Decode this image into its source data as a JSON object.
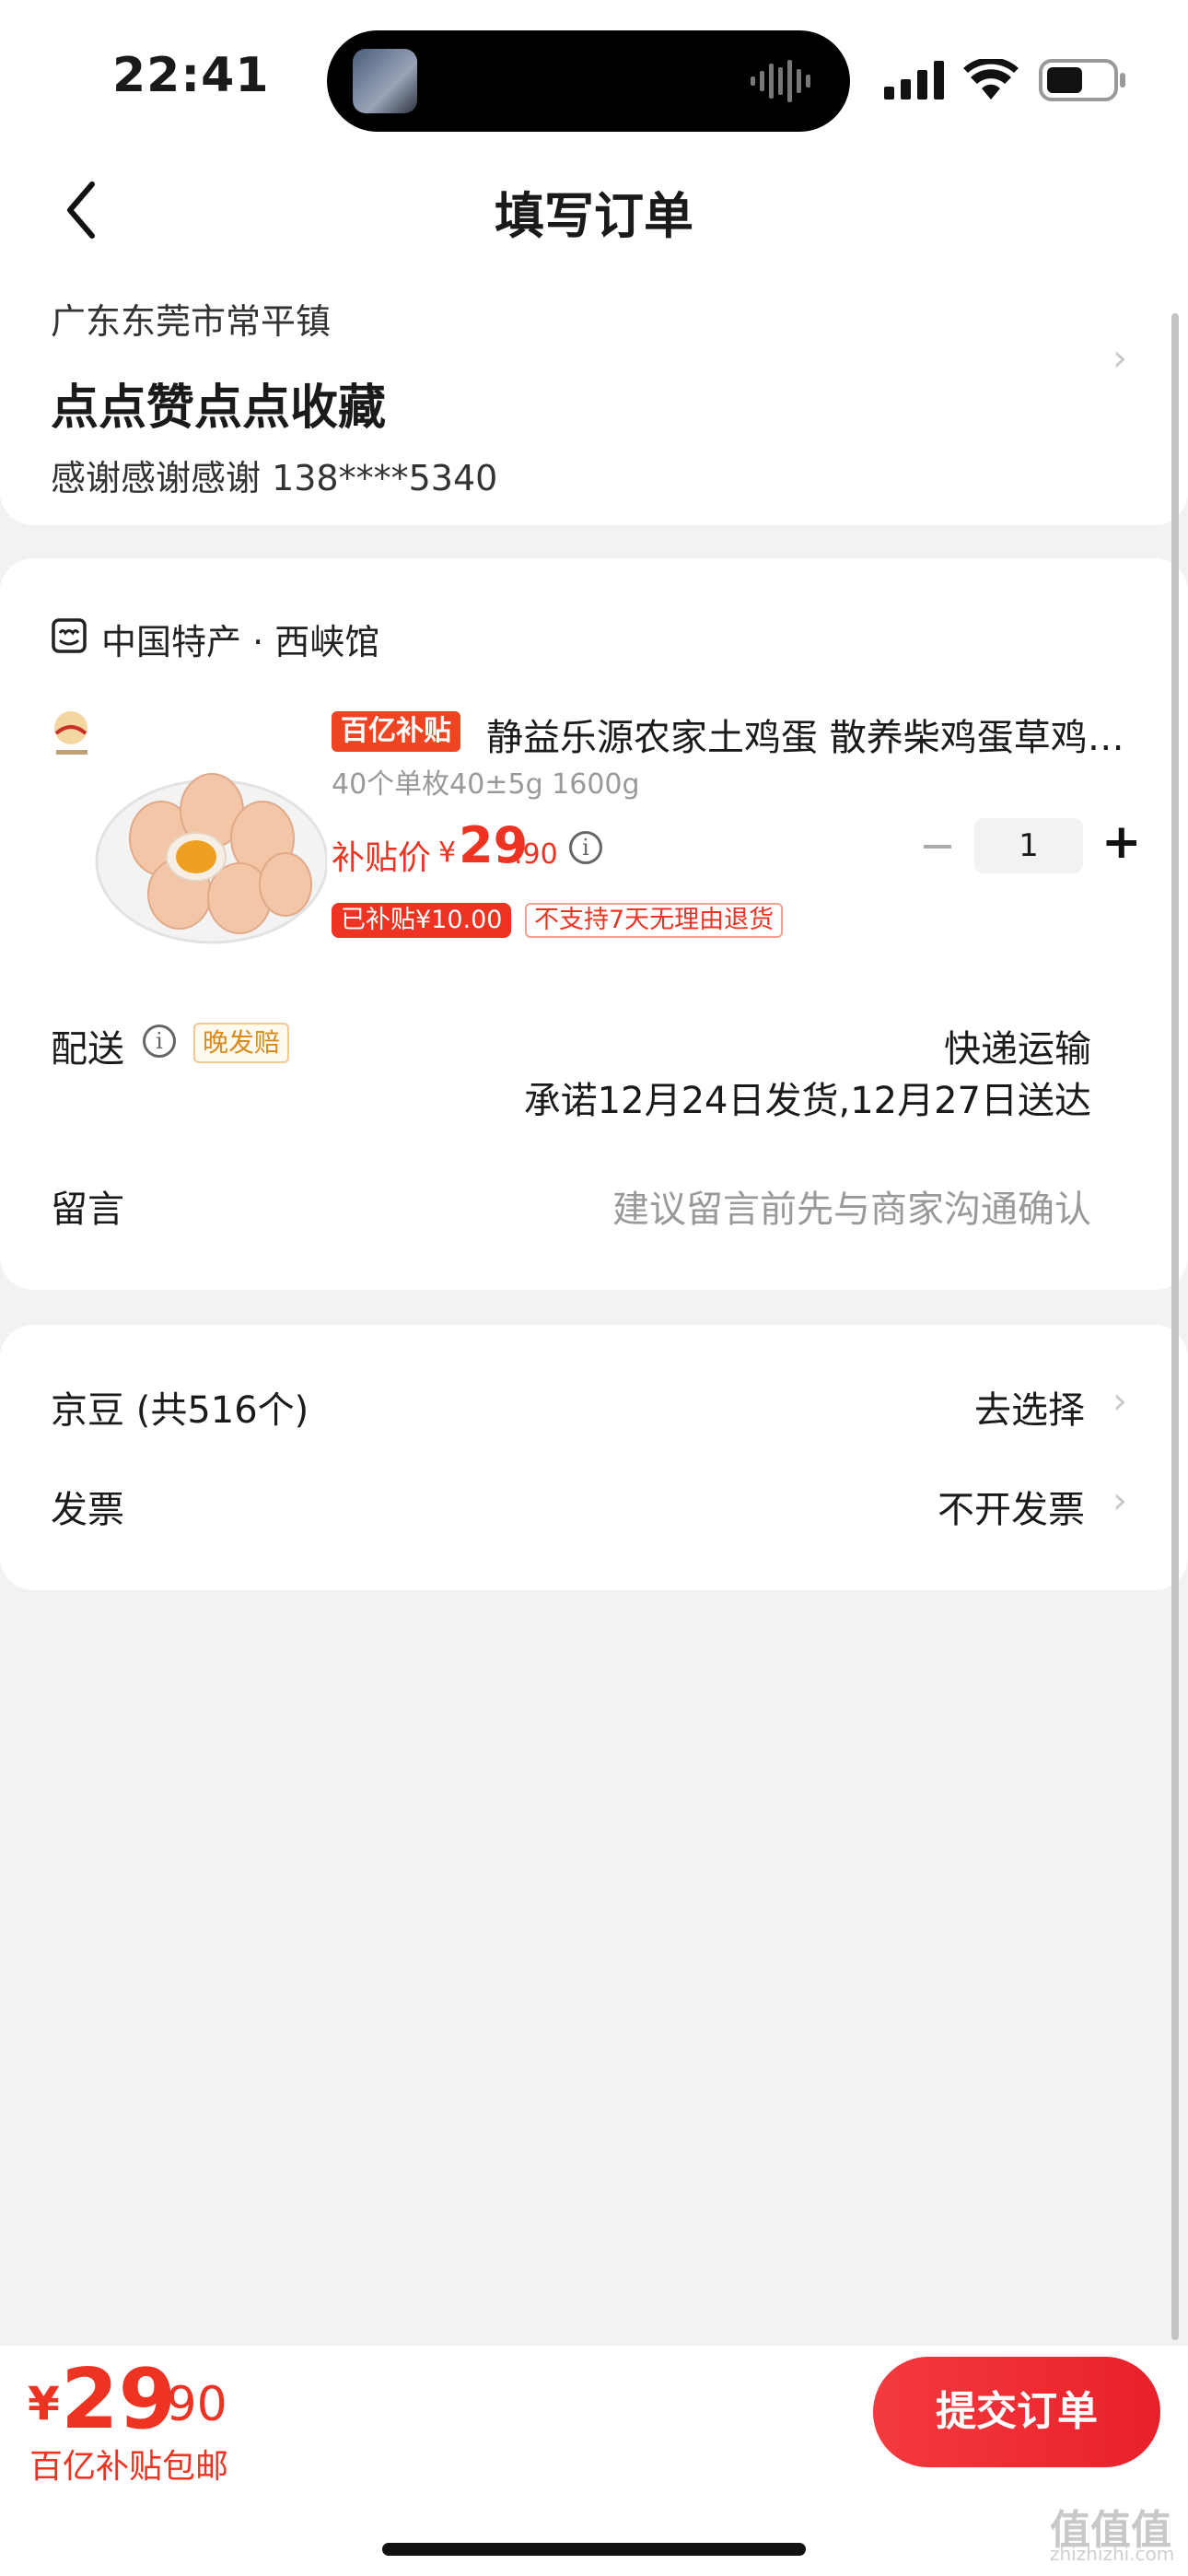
{
  "status_bar": {
    "time": "22:41"
  },
  "header": {
    "title": "填写订单"
  },
  "address": {
    "region": "广东东莞市常平镇",
    "detail": "点点赞点点收藏",
    "contact": "感谢感谢感谢  138****5340"
  },
  "shop": {
    "name": "中国特产 · 西峡馆",
    "product": {
      "badge": "百亿补贴",
      "title": "静益乐源农家土鸡蛋 散养柴鸡蛋草鸡…",
      "spec": "40个单枚40±5g 1600g",
      "price_label": "补贴价",
      "price_yen": "¥",
      "price_int": "29",
      "price_dec": ".90",
      "quantity": "1",
      "subsidy_tag": "已补贴¥10.00",
      "return_tag": "不支持7天无理由退货"
    },
    "delivery": {
      "label": "配送",
      "late_tag": "晚发赔",
      "method": "快递运输",
      "promise": "承诺12月24日发货,12月27日送达"
    },
    "message": {
      "label": "留言",
      "placeholder": "建议留言前先与商家沟通确认"
    }
  },
  "extras": {
    "jingdou_label": "京豆 (共516个)",
    "jingdou_value": "去选择",
    "invoice_label": "发票",
    "invoice_value": "不开发票"
  },
  "footer": {
    "total_yen": "¥",
    "total_int": "29",
    "total_dec": ".90",
    "total_note": "百亿补贴包邮",
    "submit_label": "提交订单"
  },
  "watermark": {
    "main": "值值值",
    "sub": "zhizhizhi.com"
  },
  "colors": {
    "accent": "#ee3322",
    "background": "#f2f2f2"
  }
}
